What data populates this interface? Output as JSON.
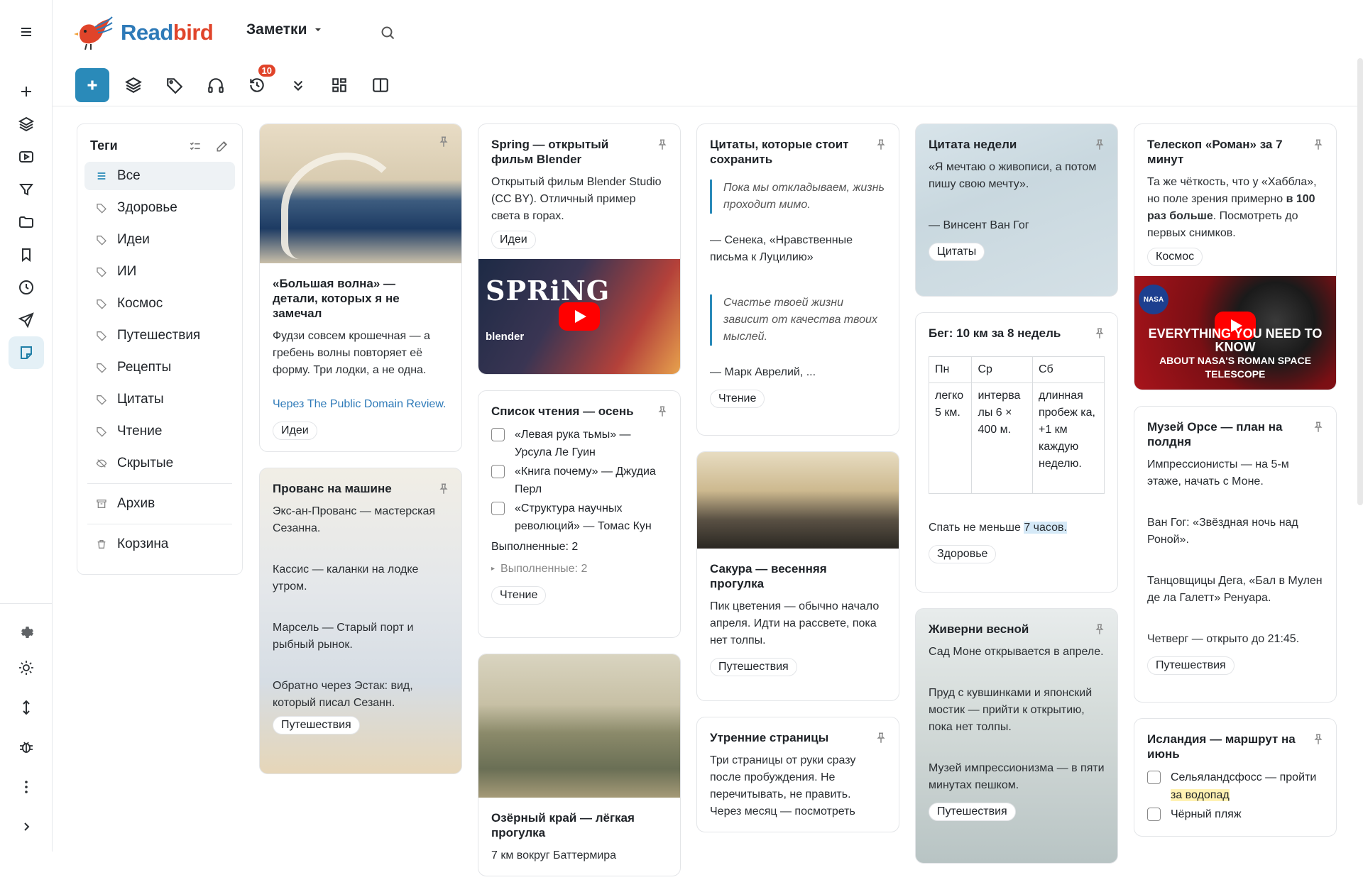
{
  "app": {
    "name_a": "Read",
    "name_b": "bird",
    "section": "Заметки",
    "badge": "10"
  },
  "tags": {
    "title": "Теги",
    "items": [
      "Все",
      "Здоровье",
      "Идеи",
      "ИИ",
      "Космос",
      "Путешествия",
      "Рецепты",
      "Цитаты",
      "Чтение"
    ],
    "hidden": "Скрытые",
    "archive": "Архив",
    "trash": "Корзина"
  },
  "cards": {
    "wave": {
      "title": "«Большая волна» — детали, которых я не замечал",
      "text": "Фудзи совсем крошечная — а гребень волны повторяет её форму. Три лодки, а не одна.",
      "link": "Через The Public Domain Review.",
      "tag": "Идеи"
    },
    "provence": {
      "title": "Прованс на машине",
      "p1": "Экс-ан-Прованс — мастерская Сезанна.",
      "p2": "Кассис — каланки на лодке утром.",
      "p3": "Марсель — Старый порт и рыбный рынок.",
      "p4": "Обратно через Эстак: вид, который писал Сезанн.",
      "tag": "Путешествия"
    },
    "spring": {
      "title": "Spring — открытый фильм Blender",
      "text": "Открытый фильм Blender Studio (CC BY). Отличный пример света в горах.",
      "tag": "Идеи",
      "video_title": "SPRiNG",
      "video_brand": "blender"
    },
    "reading": {
      "title": "Список чтения — осень",
      "items": [
        "«Левая рука тьмы» — Урсула Ле Гуин",
        "«Книга почему» — Джудиа Перл",
        "«Структура научных революций» — Томас Кун"
      ],
      "done": "Выполненные: 2",
      "done_collapsed": "Выполненные: 2",
      "tag": "Чтение"
    },
    "lake": {
      "title": "Озёрный край — лёгкая прогулка",
      "text": "7 км вокруг Баттермира"
    },
    "quotes": {
      "title": "Цитаты, которые стоит сохранить",
      "q1": "Пока мы откладываем, жизнь проходит мимо.",
      "a1": "— Сенека, «Нравственные письма к Луцилию»",
      "q2": "Счастье твоей жизни зависит от качества твоих мыслей.",
      "a2": "— Марк Аврелий, ...",
      "tag": "Чтение"
    },
    "sakura": {
      "title": "Сакура — весенняя прогулка",
      "text": "Пик цветения — обычно начало апреля. Идти на рассвете, пока нет толпы.",
      "tag": "Путешествия"
    },
    "morning": {
      "title": "Утренние страницы",
      "text": "Три страницы от руки сразу после пробуждения. Не перечитывать, не править.",
      "tail": "Через месяц — посмотреть"
    },
    "week": {
      "title": "Цитата недели",
      "text": "«Я мечтаю о живописи, а потом пишу свою мечту».",
      "author": "— Винсент Ван Гог",
      "tag": "Цитаты"
    },
    "run": {
      "title": "Бег: 10 км за 8 недель",
      "headers": [
        "Пн",
        "Ср",
        "Сб"
      ],
      "cells": [
        "легко 5 км.",
        "интерва лы 6 × 400 м.",
        "длинная пробеж ка, +1 км каждую неделю."
      ],
      "sleep_pre": "Спать не меньше ",
      "sleep_hl": "7 часов.",
      "tag": "Здоровье"
    },
    "giverny": {
      "title": "Живерни весной",
      "p1": "Сад Моне открывается в апреле.",
      "p2": "Пруд с кувшинками и японский мостик — прийти к открытию, пока нет толпы.",
      "p3": "Музей импрессионизма — в пяти минутах пешком.",
      "tag": "Путешествия"
    },
    "telescope": {
      "title": "Телескоп «Роман» за 7 минут",
      "text_a": "Та же чёткость, что у «Хаббла», но поле зрения примерно ",
      "text_b": "в 100 раз больше",
      "text_c": ". Посмотреть до первых снимков.",
      "tag": "Космос",
      "video_line1": "EVERYTHING YOU NEED TO KNOW",
      "video_line2": "ABOUT NASA'S ROMAN SPACE TELESCOPE",
      "video_brand": "NASA"
    },
    "orsay": {
      "title": "Музей Орсе — план на полдня",
      "p1": "Импрессионисты — на 5-м этаже, начать с Моне.",
      "p2": "Ван Гог: «Звёздная ночь над Роной».",
      "p3": "Танцовщицы Дега, «Бал в Мулен де ла Галетт» Ренуара.",
      "p4": "Четверг — открыто до 21:45.",
      "tag": "Путешествия"
    },
    "iceland": {
      "title": "Исландия — маршрут на июнь",
      "i1_pre": "Сельяландсфосс — пройти ",
      "i1_hl": "за водопад",
      "i2": "Чёрный пляж"
    }
  }
}
